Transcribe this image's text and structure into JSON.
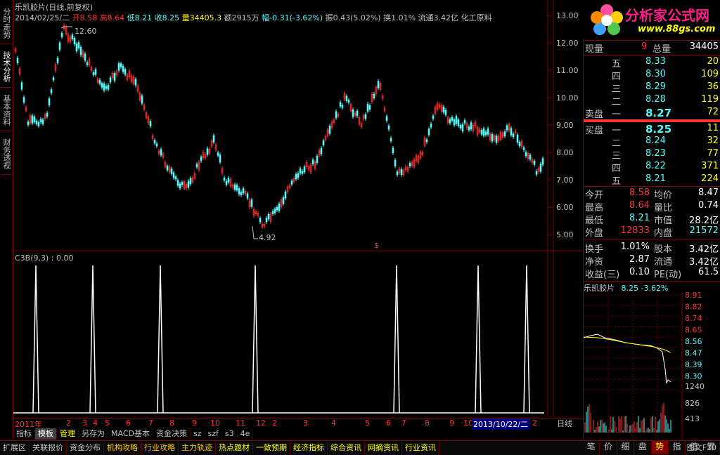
{
  "left_tabs": [
    "分时走势",
    "技术分析",
    "基本资料",
    "财务透视"
  ],
  "stock": {
    "name_period": "乐凯胶片(日线,前复权)",
    "date": "2014/02/25/二",
    "open_label": "开",
    "open": "8.58",
    "high_label": "高",
    "high": "8.64",
    "low_label": "低",
    "low": "8.21",
    "close_label": "收",
    "close": "8.25",
    "vol_label": "量",
    "vol": "34405.3",
    "amount_label": "额",
    "amount": "2915万",
    "chg_label": "幅",
    "chg": "-0.31(-3.62%)",
    "amp_label": "振",
    "amp": "0.43(5.02%)",
    "turn_label": "换",
    "turn": "1.01%",
    "float_label": "流通",
    "float": "3.42亿",
    "industry": "化工原料"
  },
  "price_axis": [
    "13.00",
    "12.00",
    "11.00",
    "10.00",
    "9.00",
    "8.00",
    "7.00",
    "6.00",
    "5.00"
  ],
  "annotations": {
    "high_mark": "12.60",
    "low_mark": "4.92"
  },
  "indicator": {
    "label": "C3B(9,3) : 0.00"
  },
  "date_axis": [
    "2011年",
    "2",
    "3",
    "4",
    "5",
    "6",
    "7",
    "8",
    "9",
    "10",
    "11",
    "12",
    "2",
    "3",
    "4",
    "5",
    "6",
    "7",
    "8",
    "9",
    "10",
    "2013/10/22/二",
    "2"
  ],
  "period": "日线",
  "toolbar1": [
    "指标",
    "模板",
    "管理",
    "另存为",
    "MACD基本",
    "资金决策",
    "sz",
    "szf",
    "s3",
    "4e"
  ],
  "toolbar2": [
    "扩展区",
    "关联报价",
    "资金分布",
    "机构攻略",
    "行业攻略",
    "主力轨迹",
    "热点题材",
    "一致预期",
    "经济指标",
    "综合资讯",
    "网摘资讯",
    "行业资讯",
    "图文F10"
  ],
  "logo": {
    "text": "分析家公式网",
    "url": "www.88gs.com"
  },
  "quote": {
    "cur_vol_label": "现量",
    "cur_vol": "9",
    "total_vol_label": "总量",
    "total_vol": "34405",
    "asks": [
      {
        "label": "五",
        "price": "8.33",
        "vol": "20"
      },
      {
        "label": "四",
        "price": "8.30",
        "vol": "109"
      },
      {
        "label": "三",
        "price": "8.29",
        "vol": "36"
      },
      {
        "label": "二",
        "price": "8.28",
        "vol": "119"
      },
      {
        "label": "卖盘 一",
        "price": "8.27",
        "vol": "72"
      }
    ],
    "bids": [
      {
        "label": "买盘 一",
        "price": "8.25",
        "vol": "11"
      },
      {
        "label": "二",
        "price": "8.24",
        "vol": "32"
      },
      {
        "label": "三",
        "price": "8.23",
        "vol": "77"
      },
      {
        "label": "四",
        "price": "8.22",
        "vol": "371"
      },
      {
        "label": "五",
        "price": "8.21",
        "vol": "224"
      }
    ],
    "stats": [
      {
        "l1": "今开",
        "v1": "8.58",
        "l2": "均价",
        "v2": "8.47"
      },
      {
        "l1": "最高",
        "v1": "8.64",
        "l2": "量比",
        "v2": "0.74"
      },
      {
        "l1": "最低",
        "v1": "8.21",
        "l2": "市值",
        "v2": "28.2亿"
      },
      {
        "l1": "外盘",
        "v1": "12833",
        "l2": "内盘",
        "v2": "21572"
      }
    ],
    "fund": [
      {
        "l1": "换手",
        "v1": "1.01%",
        "l2": "股本",
        "v2": "3.42亿"
      },
      {
        "l1": "净资",
        "v1": "2.87",
        "l2": "流通",
        "v2": "3.42亿"
      },
      {
        "l1": "收益(三)",
        "v1": "0.10",
        "l2": "PE(动)",
        "v2": "61.5"
      }
    ]
  },
  "mini": {
    "title": "乐凯胶片",
    "price": "8.25",
    "pct": "-3.62%",
    "axis": [
      "8.91",
      "8.82",
      "8.74",
      "8.65",
      "8.56",
      "8.47",
      "8.39",
      "8.30",
      "1240",
      "826",
      "413"
    ]
  },
  "bottom_tabs": [
    "笔",
    "价",
    "细",
    "盘",
    "势",
    "指",
    "值",
    "筹"
  ]
}
